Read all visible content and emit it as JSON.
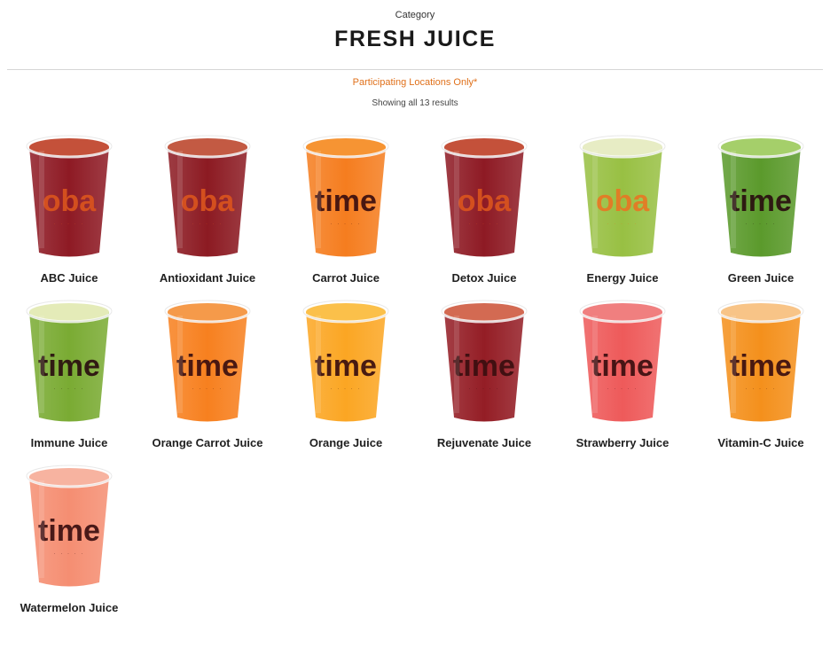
{
  "header": {
    "category_label": "Category",
    "title": "FRESH JUICE",
    "notice": "Participating Locations Only*",
    "result_count": "Showing all 13 results"
  },
  "colors": {
    "accent": "#e0701a",
    "title": "#1a1a1a"
  },
  "products": [
    {
      "name": "ABC Juice",
      "juice_color": "#8e1a24",
      "top_color": "#c4513a",
      "logo_text": "oba",
      "logo_color": "#d9541e"
    },
    {
      "name": "Antioxidant Juice",
      "juice_color": "#8c1a22",
      "top_color": "#c35a43",
      "logo_text": "oba",
      "logo_color": "#d9541e"
    },
    {
      "name": "Carrot Juice",
      "juice_color": "#f57d1f",
      "top_color": "#f69433",
      "logo_text": "time",
      "logo_color": "#3a0f10"
    },
    {
      "name": "Detox Juice",
      "juice_color": "#8e1a24",
      "top_color": "#c4513a",
      "logo_text": "oba",
      "logo_color": "#d9541e"
    },
    {
      "name": "Energy Juice",
      "juice_color": "#98c043",
      "top_color": "#e7ecc4",
      "logo_text": "oba",
      "logo_color": "#e67824"
    },
    {
      "name": "Green Juice",
      "juice_color": "#5b9a2c",
      "top_color": "#a5cf6a",
      "logo_text": "time",
      "logo_color": "#2a0f10"
    },
    {
      "name": "Immune Juice",
      "juice_color": "#7aab33",
      "top_color": "#e4ebb8",
      "logo_text": "time",
      "logo_color": "#2a0f10"
    },
    {
      "name": "Orange Carrot Juice",
      "juice_color": "#f7801f",
      "top_color": "#f59a4a",
      "logo_text": "time",
      "logo_color": "#3a0f10"
    },
    {
      "name": "Orange Juice",
      "juice_color": "#fba623",
      "top_color": "#fbc04a",
      "logo_text": "time",
      "logo_color": "#3a0f10"
    },
    {
      "name": "Rejuvenate Juice",
      "juice_color": "#941d25",
      "top_color": "#d36a52",
      "logo_text": "time",
      "logo_color": "#3a0f10"
    },
    {
      "name": "Strawberry Juice",
      "juice_color": "#ee5a5a",
      "top_color": "#f07f7f",
      "logo_text": "time",
      "logo_color": "#3a0f10"
    },
    {
      "name": "Vitamin-C Juice",
      "juice_color": "#f4901c",
      "top_color": "#f8c487",
      "logo_text": "time",
      "logo_color": "#3a0f10"
    },
    {
      "name": "Watermelon Juice",
      "juice_color": "#f58e72",
      "top_color": "#f7b3a0",
      "logo_text": "time",
      "logo_color": "#3a0f10"
    }
  ]
}
